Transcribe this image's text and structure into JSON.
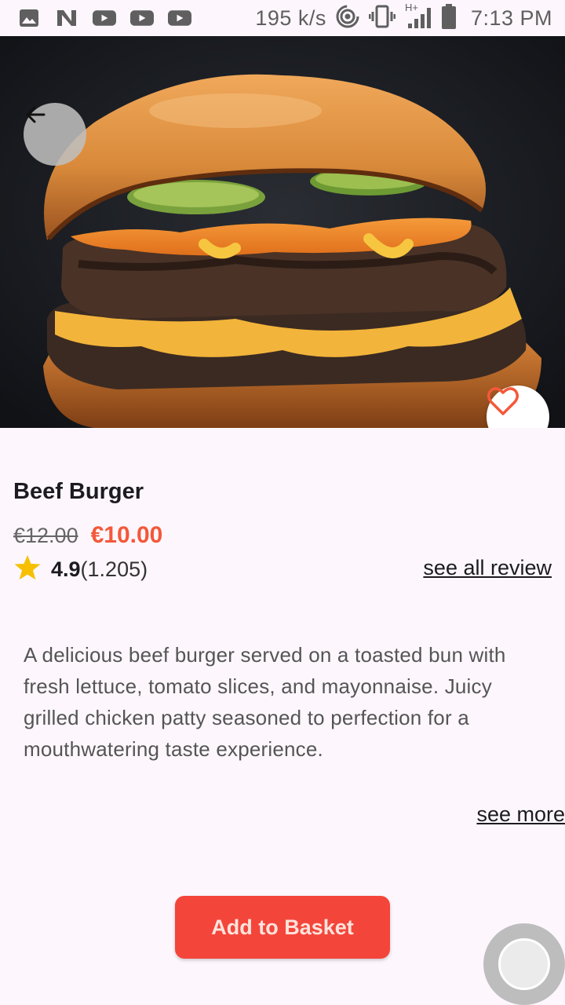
{
  "status_bar": {
    "speed": "195 k/s",
    "time": "7:13 PM",
    "network_label": "H+",
    "icons": [
      "image-icon",
      "n-app-icon",
      "youtube-icon",
      "youtube-icon",
      "youtube-icon",
      "hotspot-icon",
      "vibrate-icon",
      "signal-icon",
      "battery-icon"
    ]
  },
  "hero": {
    "image": "beef-burger-photo",
    "back_icon": "arrow-left-icon",
    "favorite_icon": "heart-outline-icon",
    "accent_color": "#f4583a"
  },
  "product": {
    "title": "Beef Burger",
    "old_price": "€12.00",
    "price": "€10.00",
    "rating": "4.9",
    "rating_count": "(1.205)",
    "see_all_review": "see all review",
    "description": "A delicious beef burger served on a toasted bun with fresh lettuce, tomato slices, and mayonnaise. Juicy grilled chicken patty seasoned to perfection for a mouthwatering taste experience.",
    "see_more": "see more",
    "star_color": "#f6c000"
  },
  "actions": {
    "add_to_basket": "Add to Basket",
    "button_color": "#f4453b"
  }
}
